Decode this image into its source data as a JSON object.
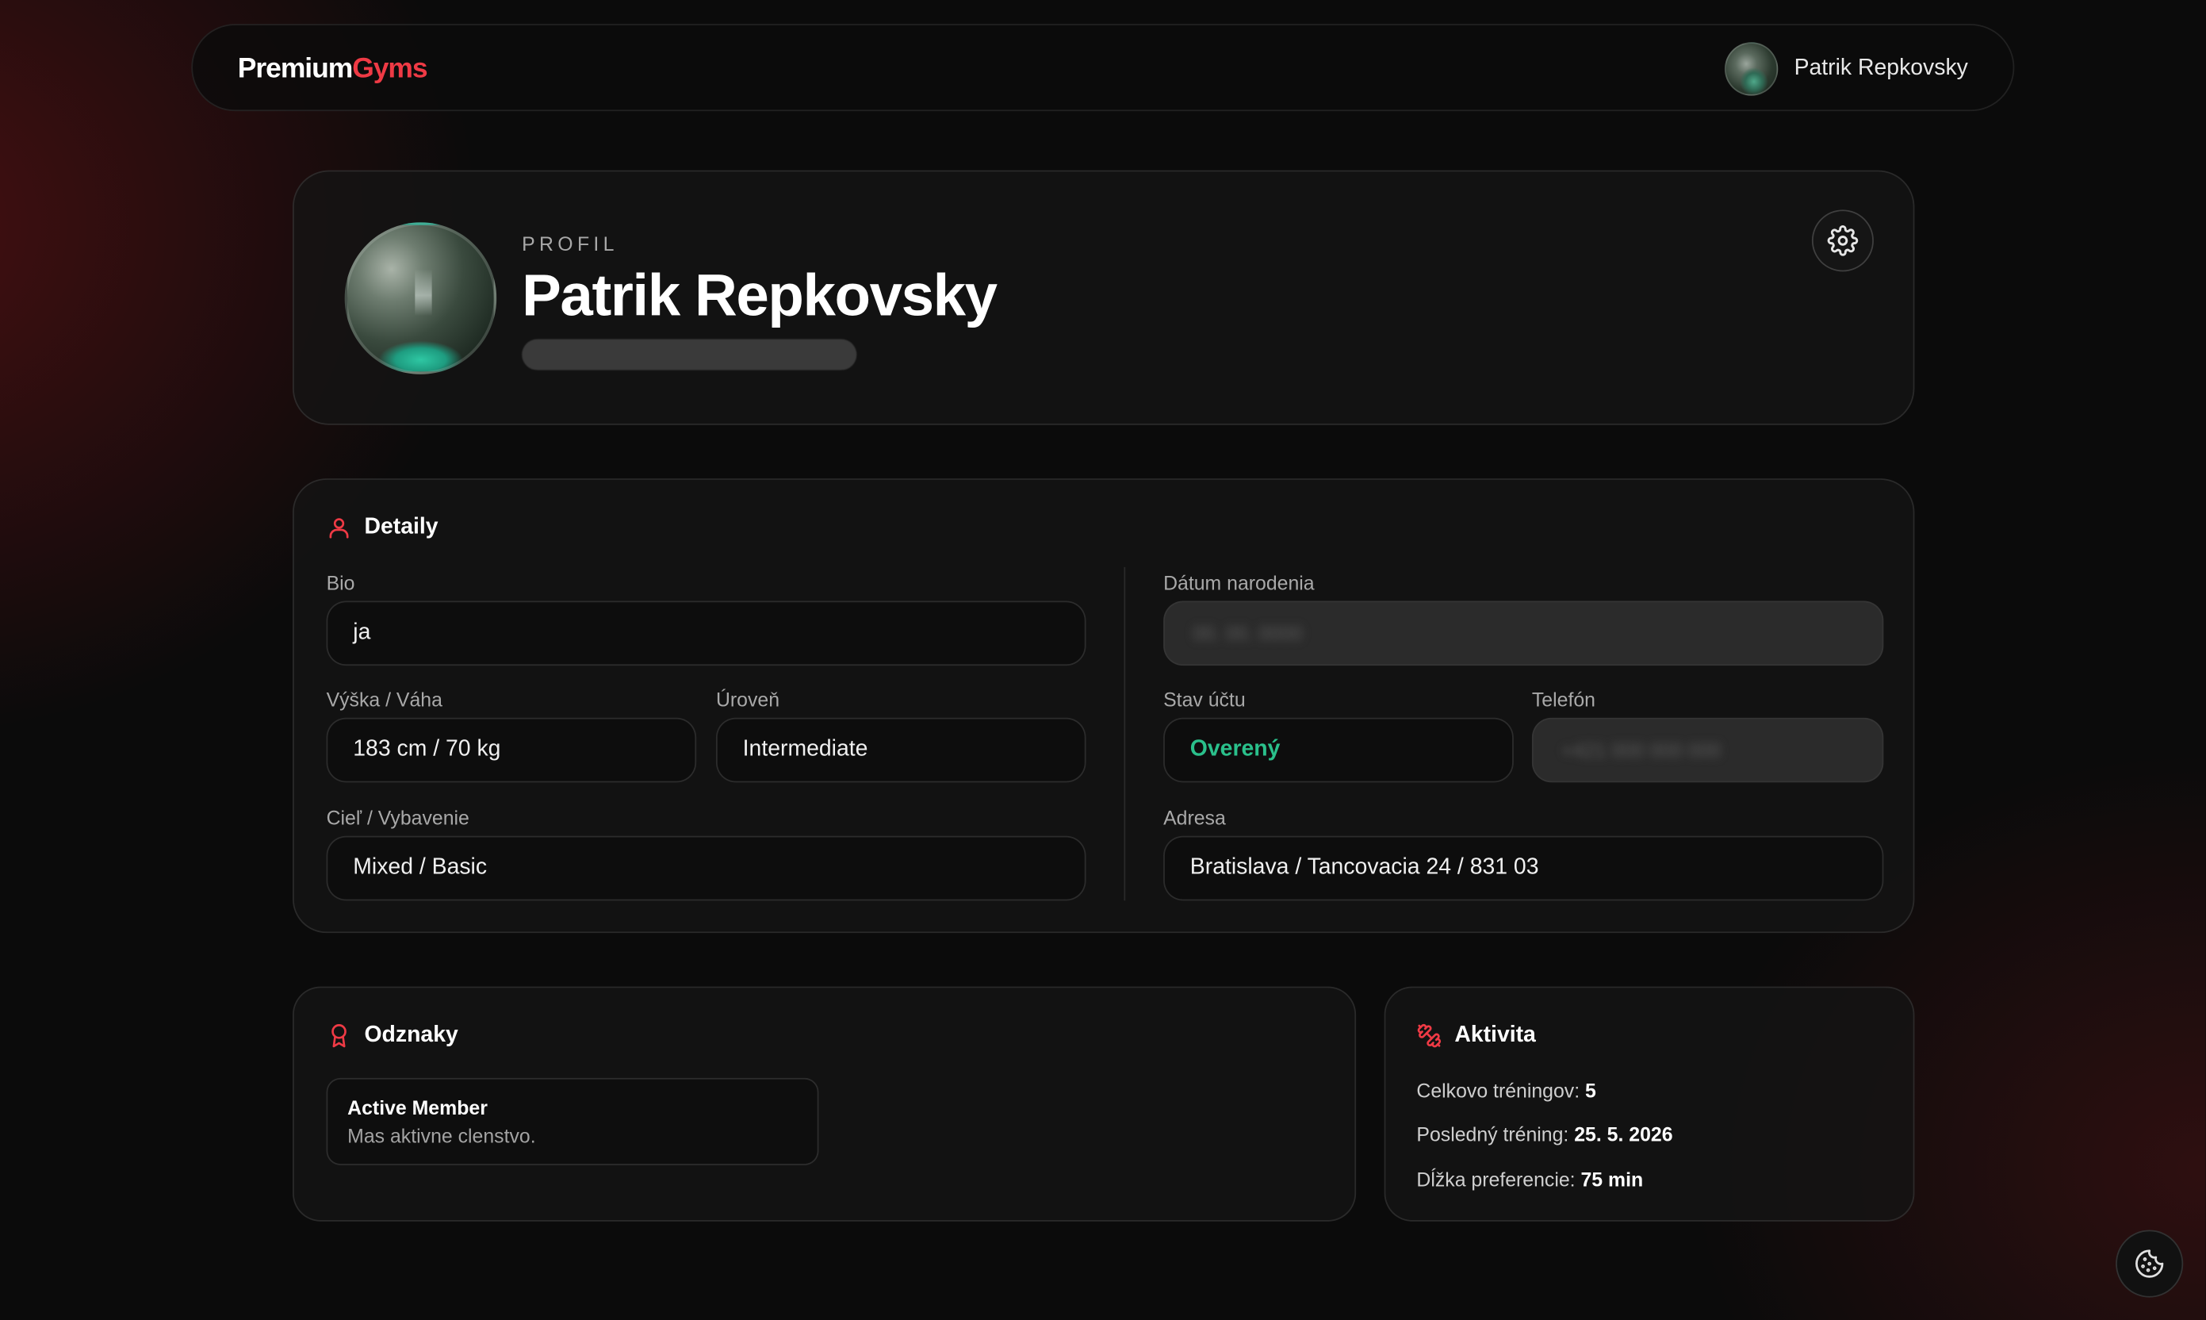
{
  "header": {
    "logo_part1": "Premium",
    "logo_part2": "Gyms",
    "user_name": "Patrik Repkovsky"
  },
  "profile": {
    "eyebrow": "PROFIL",
    "name": "Patrik Repkovsky",
    "email_placeholder": "hidden"
  },
  "details": {
    "title": "Detaily",
    "bio_label": "Bio",
    "bio_value": "ja",
    "height_weight_label": "Výška / Váha",
    "height_weight_value": "183 cm / 70 kg",
    "level_label": "Úroveň",
    "level_value": "Intermediate",
    "goal_label": "Cieľ / Vybavenie",
    "goal_value": "Mixed / Basic",
    "birth_label": "Dátum narodenia",
    "birth_value": "00. 00. 0000",
    "status_label": "Stav účtu",
    "status_value": "Overený",
    "phone_label": "Telefón",
    "phone_value": "+421 000 000 000",
    "address_label": "Adresa",
    "address_value": "Bratislava / Tancovacia 24 / 831 03"
  },
  "badges": {
    "title": "Odznaky",
    "items": [
      {
        "title": "Active Member",
        "description": "Mas aktivne clenstvo."
      }
    ]
  },
  "activity": {
    "title": "Aktivita",
    "total_label": "Celkovo tréningov:",
    "total_value": "5",
    "last_label": "Posledný tréning:",
    "last_value": "25. 5. 2026",
    "pref_label": "Dĺžka preferencie:",
    "pref_value": "75 min"
  },
  "colors": {
    "accent": "#ef3a45",
    "verified": "#2ac08b",
    "background": "#0b0b0b"
  },
  "icons": {
    "settings": "gear-icon",
    "details": "user-icon",
    "badges": "award-icon",
    "activity": "dumbbell-icon",
    "cookie": "cookie-icon"
  }
}
